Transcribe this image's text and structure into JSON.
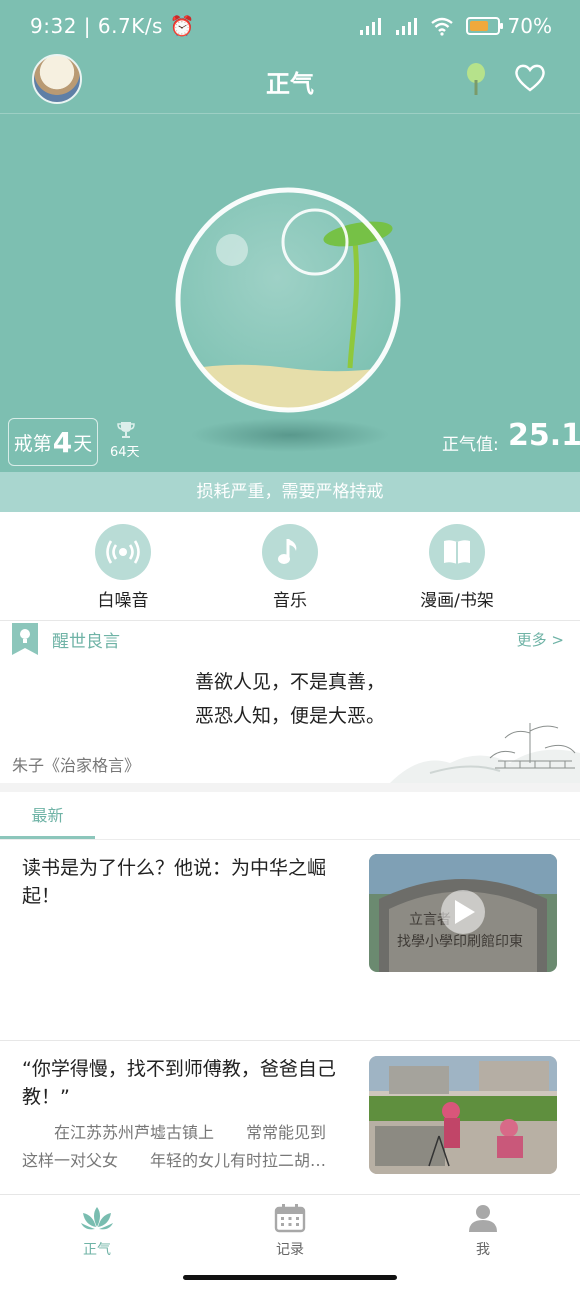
{
  "status_bar": {
    "time": "9:32",
    "speed": "6.7K/s",
    "battery_percent": "70%",
    "battery_level": 0.7
  },
  "app_bar": {
    "title": "正气"
  },
  "hero": {
    "days_prefix": "戒第",
    "days_value": "4",
    "days_suffix": "天",
    "best_days": "64天",
    "zhengqi_label": "正气值:",
    "zhengqi_value": "25.1",
    "warning": "损耗严重，需要严格持戒"
  },
  "actions": [
    {
      "label": "白噪音",
      "icon": "broadcast-icon"
    },
    {
      "label": "音乐",
      "icon": "music-note-icon"
    },
    {
      "label": "漫画/书架",
      "icon": "book-icon"
    }
  ],
  "quote_card": {
    "title": "醒世良言",
    "more": "更多 >",
    "lines": [
      "善欲人见，不是真善，",
      "恶恐人知，便是大恶。"
    ],
    "author": "朱子《治家格言》"
  },
  "news": {
    "tab": "最新",
    "items": [
      {
        "title": "读书是为了什么？他说：为中华之崛起！",
        "summary": "",
        "thumb_caption": "立言者 找學小學印刷館印東"
      },
      {
        "title": "“你学得慢，找不到师傅教，爸爸自己教！”",
        "summary": "　　在江苏苏州芦墟古镇上　　常常能见到\n这样一对父女　　年轻的女儿有时拉二胡…",
        "thumb_caption": ""
      }
    ]
  },
  "bottom_nav": [
    {
      "label": "正气",
      "icon": "lotus-icon",
      "active": true
    },
    {
      "label": "记录",
      "icon": "calendar-icon",
      "active": false
    },
    {
      "label": "我",
      "icon": "person-icon",
      "active": false
    }
  ],
  "colors": {
    "primary": "#7dbfb1",
    "accent": "#6fb3a6",
    "warning_bar": "#a9d6cf"
  }
}
